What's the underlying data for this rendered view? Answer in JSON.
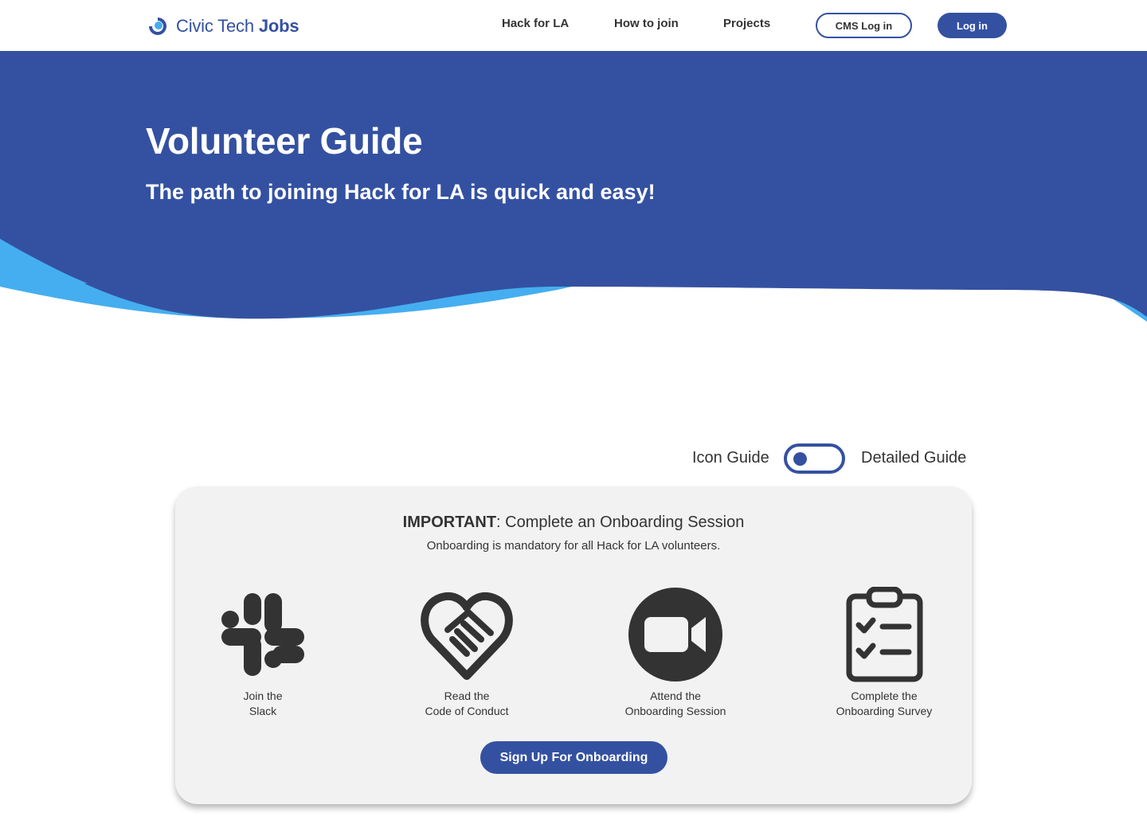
{
  "header": {
    "logo": {
      "word1": "Civic Tech",
      "word2": "Jobs"
    },
    "nav": [
      {
        "label": "Hack for LA"
      },
      {
        "label": "How to join"
      },
      {
        "label": "Projects"
      }
    ],
    "cms_login_label": "CMS Log in",
    "login_label": "Log in"
  },
  "hero": {
    "title": "Volunteer Guide",
    "subtitle": "The path to joining Hack for LA is quick and easy!"
  },
  "toggle": {
    "left_label": "Icon Guide",
    "right_label": "Detailed Guide",
    "selected": "Icon Guide"
  },
  "card": {
    "heading_strong": "IMPORTANT",
    "heading_rest": ": Complete an Onboarding Session",
    "subheading": "Onboarding is mandatory for all Hack for LA volunteers.",
    "steps": [
      {
        "icon": "slack-icon",
        "line1": "Join the",
        "line2": "Slack"
      },
      {
        "icon": "handshake-heart-icon",
        "line1": "Read the",
        "line2": "Code of Conduct"
      },
      {
        "icon": "video-camera-icon",
        "line1": "Attend the",
        "line2": "Onboarding Session"
      },
      {
        "icon": "clipboard-checklist-icon",
        "line1": "Complete the",
        "line2": "Onboarding Survey"
      }
    ],
    "button_label": "Sign Up For Onboarding"
  },
  "colors": {
    "primary": "#3451a1",
    "accent_light": "#45aef0",
    "card_bg": "#f2f2f2",
    "icon": "#333333"
  }
}
